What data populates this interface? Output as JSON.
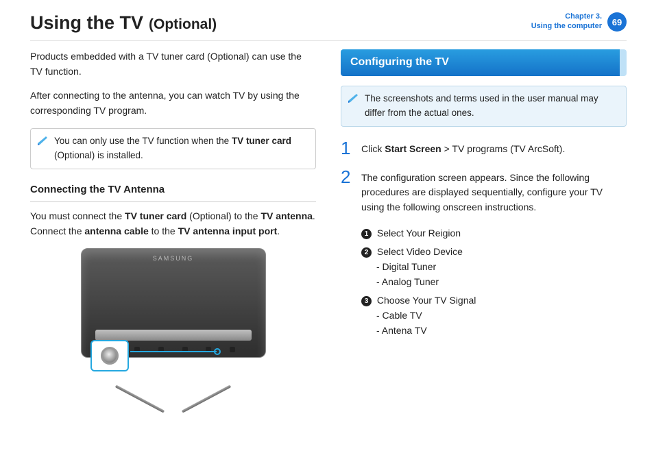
{
  "header": {
    "title": "Using the TV",
    "title_suffix": "(Optional)",
    "chapter_line1": "Chapter 3.",
    "chapter_line2": "Using the computer",
    "page_number": "69"
  },
  "left": {
    "intro1": "Products embedded with a TV tuner card (Optional) can use the TV function.",
    "intro2": "After connecting to the antenna, you can watch TV by using the corresponding TV program.",
    "note_prefix": "You can only use the TV function when the ",
    "note_bold": "TV tuner card",
    "note_suffix": " (Optional) is installed.",
    "sub1_heading": "Connecting the TV Antenna",
    "sub1_p_a": "You must connect the ",
    "sub1_b1": "TV tuner card",
    "sub1_p_b": " (Optional) to the ",
    "sub1_b2": "TV antenna",
    "sub1_p_c": ". Connect the ",
    "sub1_b3": "antenna cable",
    "sub1_p_d": " to the ",
    "sub1_b4": "TV antenna input port",
    "sub1_p_e": ".",
    "monitor_brand": "SAMSUNG"
  },
  "right": {
    "banner": "Configuring the TV",
    "note": "The screenshots and terms used in the user manual may differ from the actual ones.",
    "step1_num": "1",
    "step1_a": "Click ",
    "step1_b": "Start Screen",
    "step1_c": " > TV programs (TV ArcSoft).",
    "step2_num": "2",
    "step2_text": "The configuration screen appears. Since the following procedures are displayed sequentially, configure your TV using the following onscreen instructions.",
    "b1_num": "1",
    "b1_text": "Select Your Reigion",
    "b2_num": "2",
    "b2_text": "Select Video Device",
    "b2_opt1": "- Digital Tuner",
    "b2_opt2": "- Analog Tuner",
    "b3_num": "3",
    "b3_text": "Choose Your TV Signal",
    "b3_opt1": "- Cable TV",
    "b3_opt2": "- Antena TV"
  }
}
